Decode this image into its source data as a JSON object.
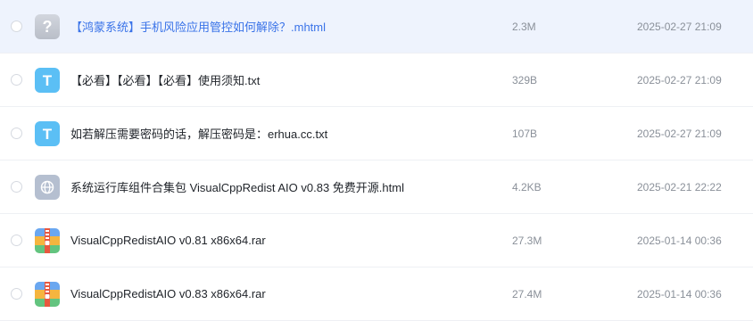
{
  "files": [
    {
      "name": "【鸿蒙系统】手机风险应用管控如何解除？.mhtml",
      "size": "2.3M",
      "date": "2025-02-27 21:09",
      "icon": "unknown-file-icon",
      "icon_glyph": "?"
    },
    {
      "name": "【必看】【必看】【必看】使用须知.txt",
      "size": "329B",
      "date": "2025-02-27 21:09",
      "icon": "text-file-icon",
      "icon_glyph": "T"
    },
    {
      "name": "如若解压需要密码的话，解压密码是：erhua.cc.txt",
      "size": "107B",
      "date": "2025-02-27 21:09",
      "icon": "text-file-icon",
      "icon_glyph": "T"
    },
    {
      "name": "系统运行库组件合集包 VisualCppRedist AIO v0.83 免费开源.html",
      "size": "4.2KB",
      "date": "2025-02-21 22:22",
      "icon": "globe-icon"
    },
    {
      "name": "VisualCppRedistAIO v0.81 x86x64.rar",
      "size": "27.3M",
      "date": "2025-01-14 00:36",
      "icon": "archive-icon"
    },
    {
      "name": "VisualCppRedistAIO v0.83 x86x64.rar",
      "size": "27.4M",
      "date": "2025-01-14 00:36",
      "icon": "archive-icon"
    }
  ],
  "colors": {
    "highlight_bg": "#eef3fd",
    "highlight_text": "#3a73e8",
    "txt_icon": "#5bbff5",
    "muted_text": "#8a9099"
  }
}
